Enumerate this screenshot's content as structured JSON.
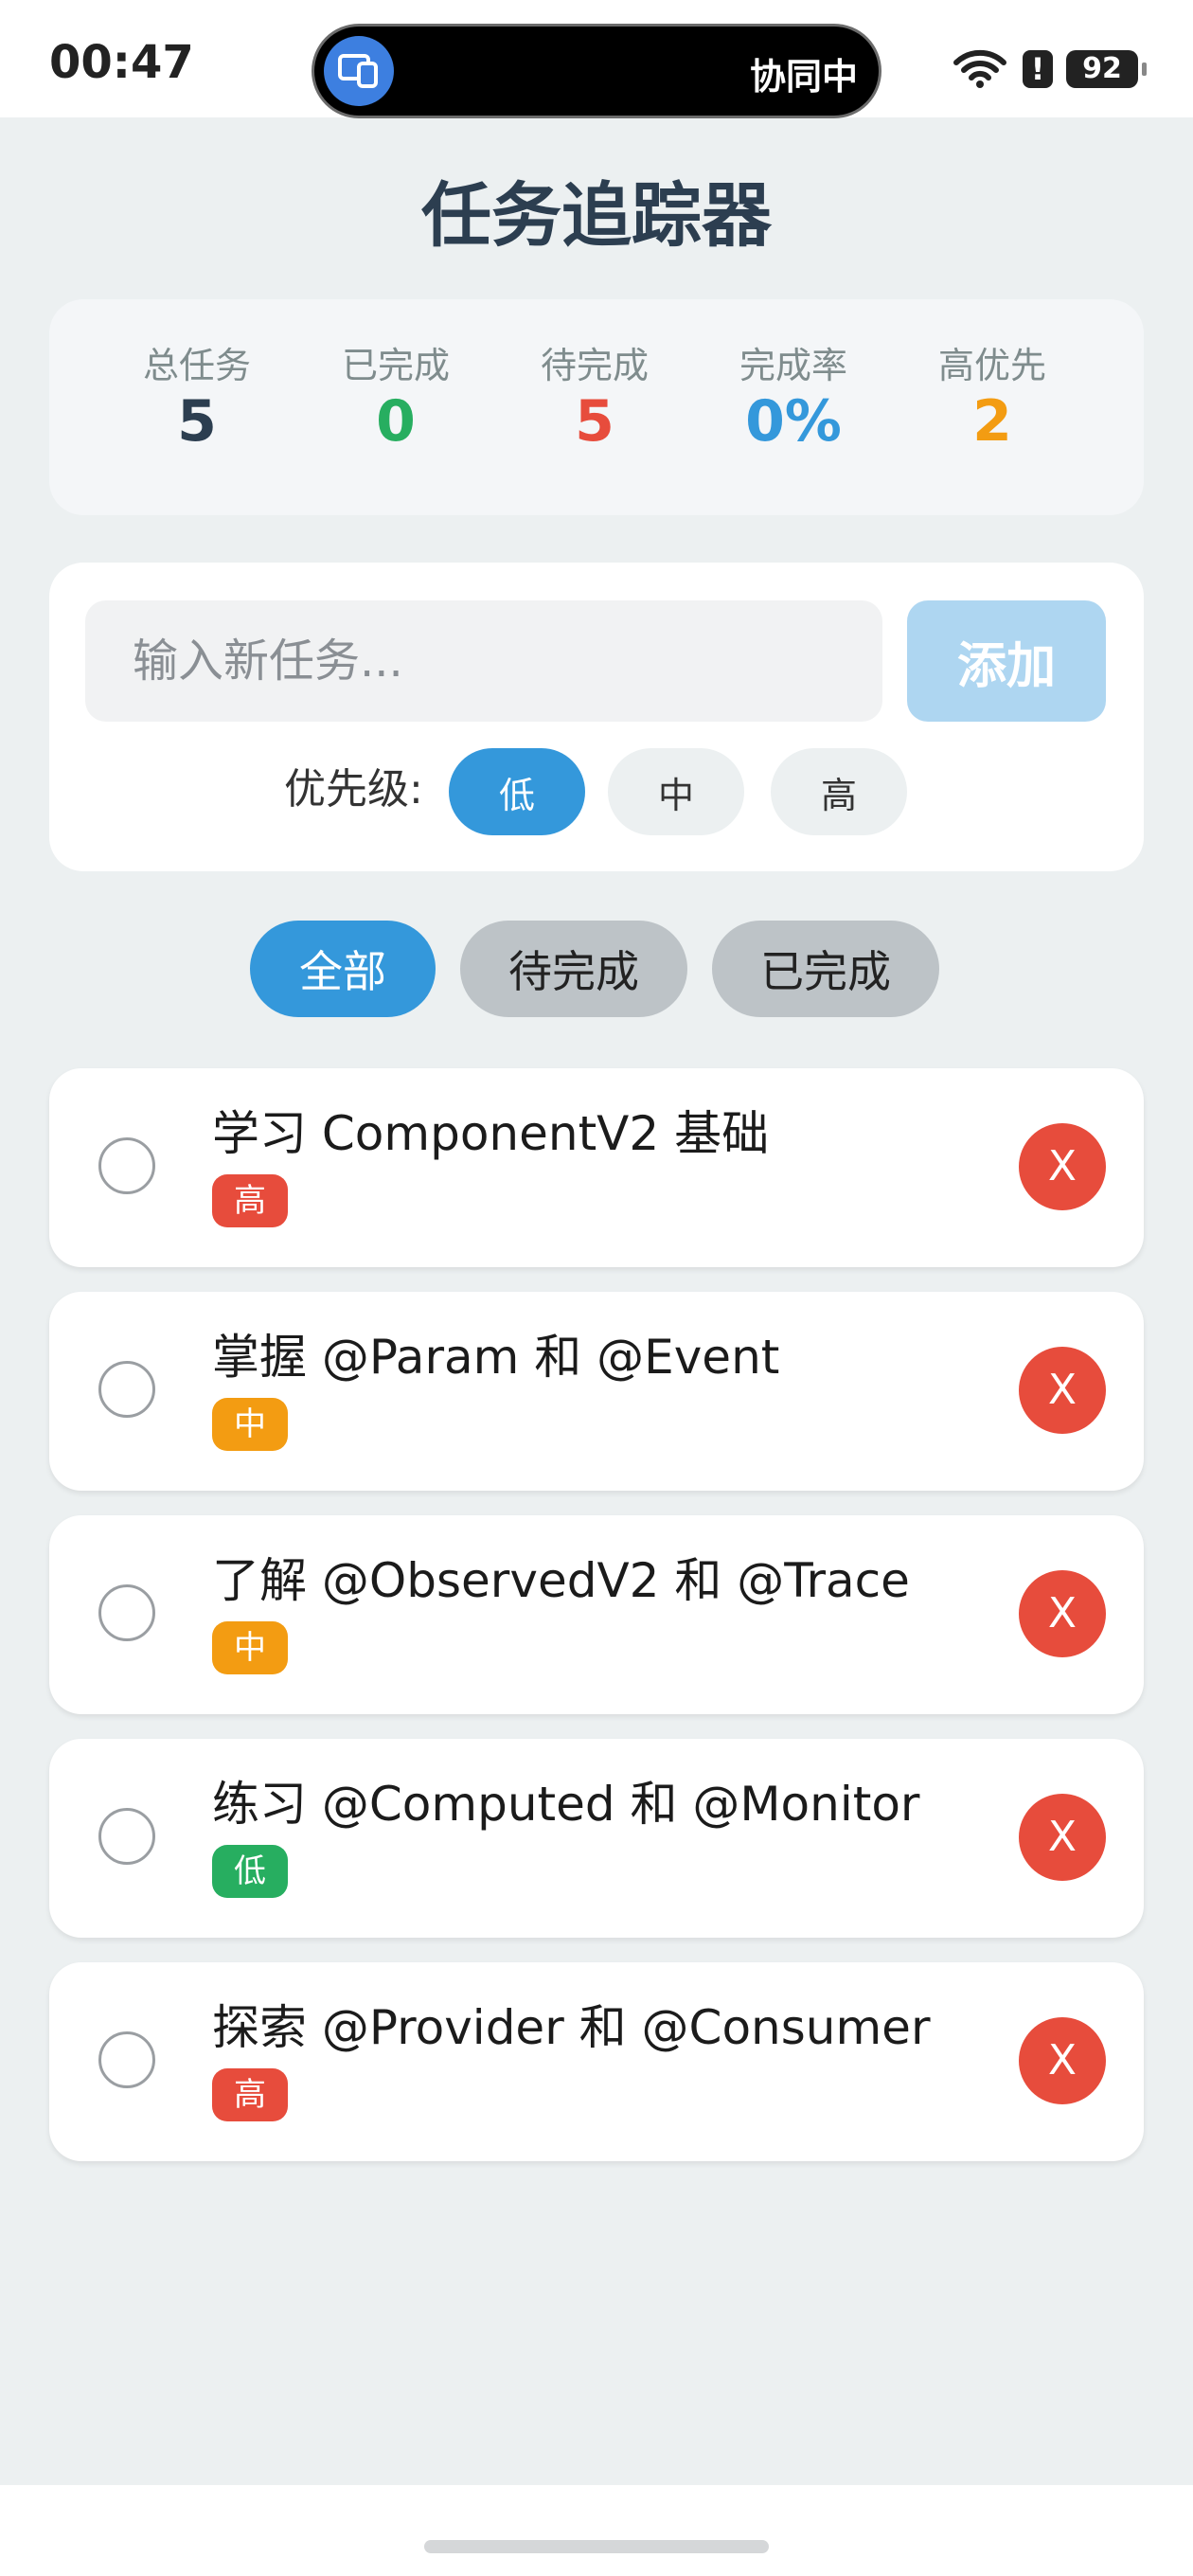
{
  "status_bar": {
    "time": "00:47",
    "island_text": "协同中",
    "battery": "92",
    "alert": "!"
  },
  "page": {
    "title": "任务追踪器"
  },
  "stats": [
    {
      "label": "总任务",
      "value": "5",
      "color": "#2c3e50"
    },
    {
      "label": "已完成",
      "value": "0",
      "color": "#27ae60"
    },
    {
      "label": "待完成",
      "value": "5",
      "color": "#e74c3c"
    },
    {
      "label": "完成率",
      "value": "0%",
      "color": "#3498db"
    },
    {
      "label": "高优先",
      "value": "2",
      "color": "#f39c12"
    }
  ],
  "input": {
    "placeholder": "输入新任务...",
    "value": "",
    "add_label": "添加",
    "priority_label": "优先级:",
    "priorities": [
      "低",
      "中",
      "高"
    ],
    "selected_priority": "低"
  },
  "filters": {
    "tabs": [
      "全部",
      "待完成",
      "已完成"
    ],
    "active": "全部"
  },
  "tasks": [
    {
      "title": "学习 ComponentV2 基础",
      "priority": "高",
      "done": false
    },
    {
      "title": "掌握 @Param 和 @Event",
      "priority": "中",
      "done": false
    },
    {
      "title": "了解 @ObservedV2 和 @Trace",
      "priority": "中",
      "done": false
    },
    {
      "title": "练习 @Computed 和 @Monitor",
      "priority": "低",
      "done": false
    },
    {
      "title": "探索 @Provider 和 @Consumer",
      "priority": "高",
      "done": false
    }
  ],
  "delete_label": "X",
  "colors": {
    "accent": "#3498db",
    "priority_high": "#e74c3c",
    "priority_medium": "#f39c12",
    "priority_low": "#27ae60",
    "background": "#ecf0f1"
  }
}
